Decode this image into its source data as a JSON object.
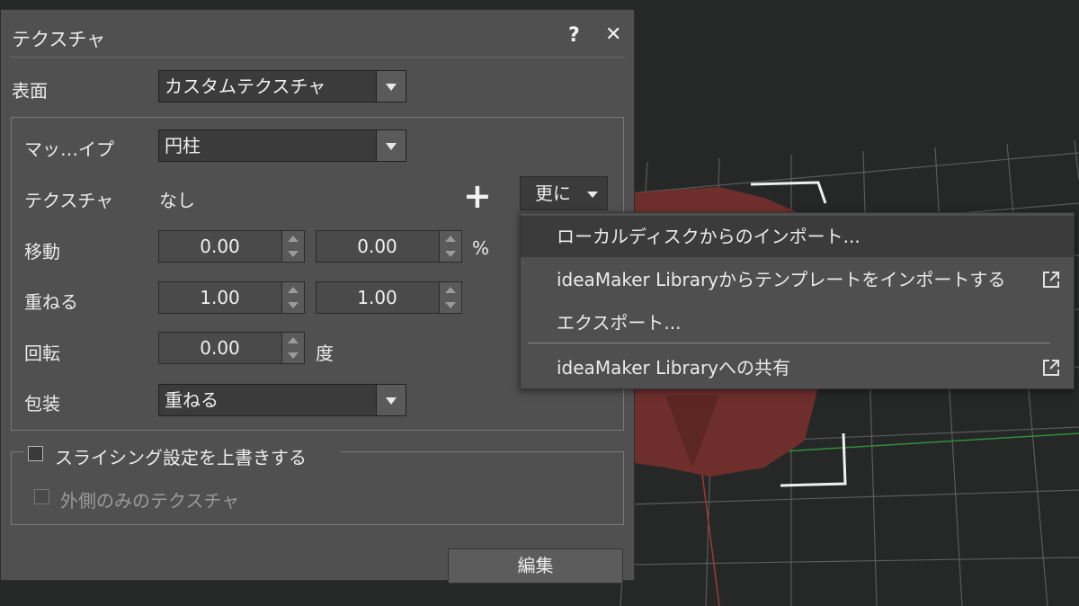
{
  "dialog": {
    "title": "テクスチャ",
    "help_label": "?",
    "close_label": "✕"
  },
  "surface": {
    "label": "表面",
    "value": "カスタムテクスチャ"
  },
  "mapping": {
    "label": "マッ…イプ",
    "value": "円柱"
  },
  "texture": {
    "label": "テクスチャ",
    "value": "なし",
    "add_label": "+",
    "more_label": "更に"
  },
  "move": {
    "label": "移動",
    "x": "0.00",
    "y": "0.00",
    "unit": "%"
  },
  "tile": {
    "label": "重ねる",
    "x": "1.00",
    "y": "1.00"
  },
  "rotate": {
    "label": "回転",
    "value": "0.00",
    "unit": "度"
  },
  "wrap": {
    "label": "包装",
    "value": "重ねる"
  },
  "override": {
    "label": "スライシング設定を上書きする",
    "checked": false,
    "outer_only_label": "外側のみのテクスチャ",
    "outer_only_checked": false
  },
  "edit_label": "編集",
  "menu": {
    "items": [
      {
        "label": "ローカルディスクからのインポート...",
        "external": false,
        "highlighted": true
      },
      {
        "label": "ideaMaker Libraryからテンプレートをインポートする",
        "external": true,
        "highlighted": false
      },
      {
        "label": "エクスポート...",
        "external": false,
        "highlighted": false
      },
      {
        "label": "ideaMaker Libraryへの共有",
        "external": true,
        "highlighted": false
      }
    ]
  },
  "colors": {
    "dialog_bg": "#505050",
    "viewport_bg": "#262828",
    "model": "#6e2f2c",
    "menu_bg": "#4f4f4f",
    "menu_highlight": "#3b3b3b"
  }
}
